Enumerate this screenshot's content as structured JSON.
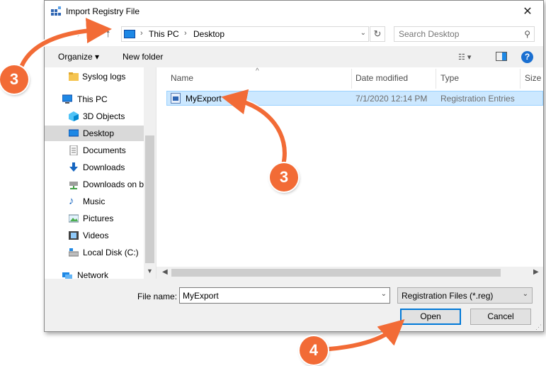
{
  "window": {
    "title": "Import Registry File",
    "close_glyph": "✕"
  },
  "address": {
    "crumbs": [
      "This PC",
      "Desktop"
    ],
    "search_placeholder": "Search Desktop"
  },
  "toolbar": {
    "organize": "Organize ▾",
    "new_folder": "New folder",
    "help": "?"
  },
  "nav": {
    "items": [
      {
        "label": "Syslog logs",
        "icon": "folder-icon"
      },
      {
        "label": "This PC",
        "icon": "pc-icon"
      },
      {
        "label": "3D Objects",
        "icon": "cube-icon"
      },
      {
        "label": "Desktop",
        "icon": "desktop-icon",
        "selected": true
      },
      {
        "label": "Documents",
        "icon": "document-icon"
      },
      {
        "label": "Downloads",
        "icon": "download-icon"
      },
      {
        "label": "Downloads on b",
        "icon": "network-drive-icon"
      },
      {
        "label": "Music",
        "icon": "music-icon"
      },
      {
        "label": "Pictures",
        "icon": "pictures-icon"
      },
      {
        "label": "Videos",
        "icon": "videos-icon"
      },
      {
        "label": "Local Disk (C:)",
        "icon": "disk-icon"
      },
      {
        "label": "Network",
        "icon": "network-icon"
      }
    ]
  },
  "columns": {
    "name": "Name",
    "date": "Date modified",
    "type": "Type",
    "size": "Size"
  },
  "files": [
    {
      "name": "MyExport",
      "date": "7/1/2020 12:14 PM",
      "type": "Registration Entries"
    }
  ],
  "bottom": {
    "file_name_label": "File name:",
    "file_name_value": "MyExport",
    "file_type": "Registration Files (*.reg)",
    "open": "Open",
    "cancel": "Cancel"
  },
  "annotations": {
    "badge_left": "3",
    "badge_middle": "3",
    "badge_bottom": "4",
    "color": "#f26b36"
  }
}
